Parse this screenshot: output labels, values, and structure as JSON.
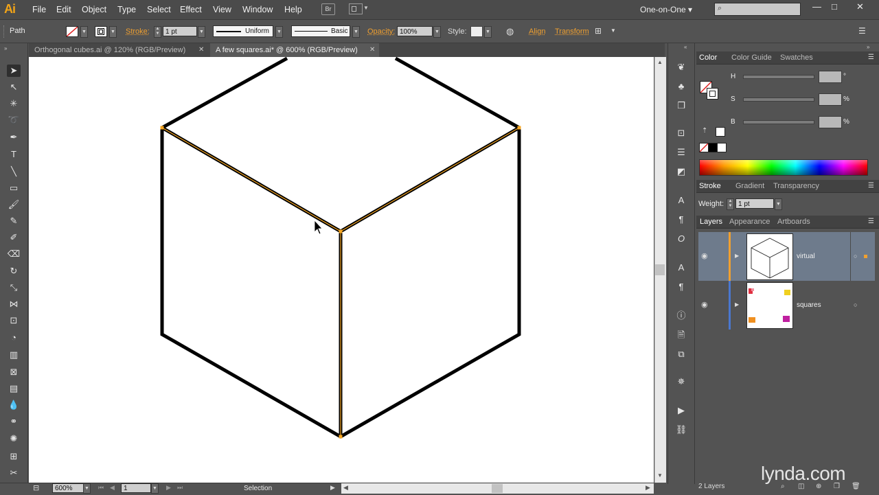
{
  "app": {
    "logo": "Ai"
  },
  "menu": [
    "File",
    "Edit",
    "Object",
    "Type",
    "Select",
    "Effect",
    "View",
    "Window",
    "Help"
  ],
  "bridge_button": "Br",
  "workspace": "One-on-One ▾",
  "window_controls": [
    "—",
    "□",
    "✕"
  ],
  "control_bar": {
    "selection_type": "Path",
    "stroke_label": "Stroke:",
    "stroke_weight": "1 pt",
    "stroke_profile": "Uniform",
    "brush": "Basic",
    "opacity_label": "Opacity:",
    "opacity_value": "100%",
    "style_label": "Style:",
    "align_label": "Align",
    "transform_label": "Transform"
  },
  "tabs": [
    {
      "label": "Orthogonal cubes.ai @ 120% (RGB/Preview)",
      "active": false
    },
    {
      "label": "A few squares.ai* @ 600% (RGB/Preview)",
      "active": true
    }
  ],
  "tab_close": "✕",
  "status_bar": {
    "zoom": "600%",
    "artboard": "1",
    "tool": "Selection"
  },
  "color_panel": {
    "tabs": [
      "Color",
      "Color Guide",
      "Swatches"
    ],
    "channels": [
      {
        "label": "H",
        "unit": "°"
      },
      {
        "label": "S",
        "unit": "%"
      },
      {
        "label": "B",
        "unit": "%"
      }
    ]
  },
  "stroke_panel": {
    "tabs": [
      "Stroke",
      "Gradient",
      "Transparency"
    ],
    "weight_label": "Weight:",
    "weight_value": "1 pt"
  },
  "layers_panel": {
    "tabs": [
      "Layers",
      "Appearance",
      "Artboards"
    ],
    "layers": [
      {
        "name": "virtual",
        "color": "#f0a030",
        "selected": true
      },
      {
        "name": "squares",
        "color": "#4a78d0",
        "selected": false
      }
    ],
    "count": "2 Layers"
  },
  "watermark": "lynda.com",
  "colors": {
    "accent": "#f0a030",
    "ui_dark": "#535353",
    "selection_outline": "#f5a623"
  }
}
